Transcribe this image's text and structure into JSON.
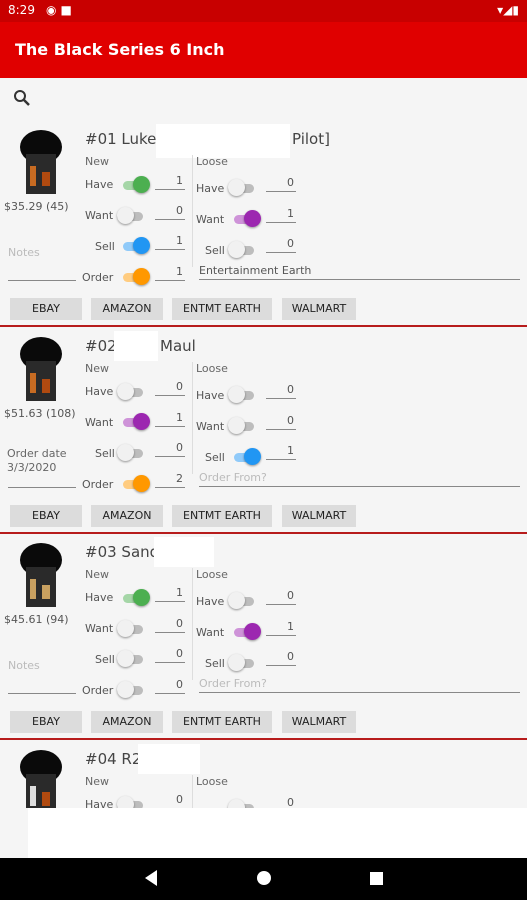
{
  "status_bar": {
    "time": "8:29"
  },
  "app_bar": {
    "title": "The Black Series 6 Inch"
  },
  "colors": {
    "green": "#4caf50",
    "purple": "#9c27b0",
    "blue": "#2196f3",
    "orange": "#ff9800",
    "accent": "#e00000"
  },
  "labels": {
    "new": "New",
    "loose": "Loose",
    "have": "Have",
    "want": "Want",
    "sell": "Sell",
    "order": "Order",
    "notes": "Notes",
    "order_from_placeholder": "Order From?",
    "ebay": "EBAY",
    "amazon": "AMAZON",
    "entmt_earth": "ENTMT EARTH",
    "walmart": "WALMART"
  },
  "items": [
    {
      "name": "#01 Luke",
      "name_suffix": "Pilot]",
      "price": "$35.29 (45)",
      "left_text": "",
      "new": {
        "have": {
          "on": true,
          "color": "green",
          "value": "1"
        },
        "want": {
          "on": false,
          "value": "0"
        },
        "sell": {
          "on": true,
          "color": "blue",
          "value": "1"
        },
        "order": {
          "on": true,
          "color": "orange",
          "value": "1"
        }
      },
      "loose": {
        "have": {
          "on": false,
          "value": "0"
        },
        "want": {
          "on": true,
          "color": "purple",
          "value": "1"
        },
        "sell": {
          "on": false,
          "value": "0"
        }
      },
      "order_from": "Entertainment Earth"
    },
    {
      "name": "#02",
      "name_suffix": "Maul",
      "price": "$51.63 (108)",
      "left_text": "Order date\n3/3/2020",
      "new": {
        "have": {
          "on": false,
          "value": "0"
        },
        "want": {
          "on": true,
          "color": "purple",
          "value": "1"
        },
        "sell": {
          "on": false,
          "value": "0"
        },
        "order": {
          "on": true,
          "color": "orange",
          "value": "2"
        }
      },
      "loose": {
        "have": {
          "on": false,
          "value": "0"
        },
        "want": {
          "on": false,
          "value": "0"
        },
        "sell": {
          "on": true,
          "color": "blue",
          "value": "1"
        }
      },
      "order_from": ""
    },
    {
      "name": "#03 Sand",
      "name_suffix": "",
      "price": "$45.61 (94)",
      "left_text": "",
      "new": {
        "have": {
          "on": true,
          "color": "green",
          "value": "1"
        },
        "want": {
          "on": false,
          "value": "0"
        },
        "sell": {
          "on": false,
          "value": "0"
        },
        "order": {
          "on": false,
          "value": "0"
        }
      },
      "loose": {
        "have": {
          "on": false,
          "value": "0"
        },
        "want": {
          "on": true,
          "color": "purple",
          "value": "1"
        },
        "sell": {
          "on": false,
          "value": "0"
        }
      },
      "order_from": ""
    },
    {
      "name": "#04 R2-",
      "name_suffix": "",
      "price": "",
      "left_text": "",
      "new": {
        "have": {
          "on": false,
          "value": "0"
        }
      },
      "loose": {
        "have": {
          "on": false,
          "value": "0"
        }
      }
    }
  ]
}
